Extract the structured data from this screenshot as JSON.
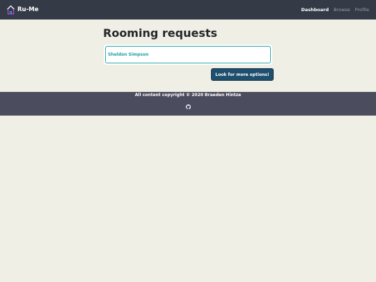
{
  "nav": {
    "brand": "Ru-Me",
    "links": [
      {
        "label": "Dashboard",
        "active": true
      },
      {
        "label": "Browse",
        "active": false
      },
      {
        "label": "Profile",
        "active": false
      }
    ]
  },
  "main": {
    "title": "Rooming requests",
    "requests": [
      {
        "name": "Sheldon Simpson"
      }
    ],
    "options_button": "Look for more options!"
  },
  "footer": {
    "copyright": "All content copyright © 2020 Braeden Hintze",
    "icon": "github-icon"
  },
  "colors": {
    "navbar": "#343a46",
    "background": "#efefe5",
    "accent": "#2aa8ac",
    "button": "#1f4f6e",
    "footer": "#4c4c5f"
  }
}
